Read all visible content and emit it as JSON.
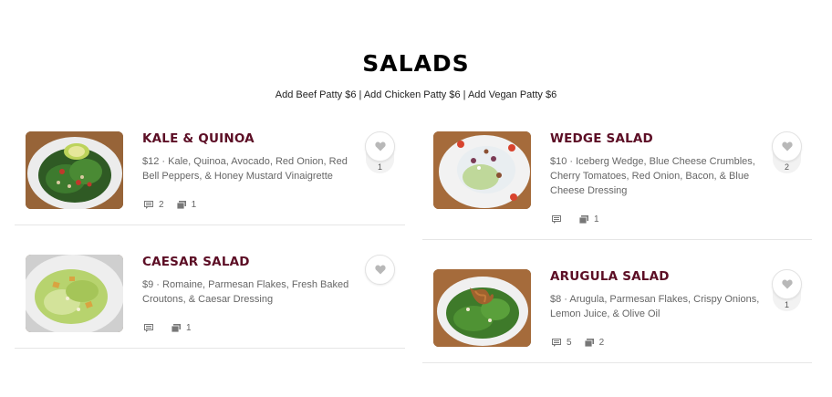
{
  "heading": "SALADS",
  "addons": "Add Beef Patty $6 | Add Chicken Patty $6 | Add Vegan Patty $6",
  "items": [
    {
      "name": "KALE & QUINOA",
      "description": "$12 · Kale, Quinoa, Avocado, Red Onion, Red Bell Peppers, & Honey Mustard Vinaigrette",
      "comments": "2",
      "photos": "1",
      "likes": "1"
    },
    {
      "name": "CAESAR SALAD",
      "description": "$9 · Romaine, Parmesan Flakes, Fresh Baked Croutons, & Caesar Dressing",
      "comments": "",
      "photos": "1",
      "likes": ""
    },
    {
      "name": "WEDGE SALAD",
      "description": "$10 · Iceberg Wedge, Blue Cheese Crumbles, Cherry Tomatoes, Red Onion, Bacon, & Blue Cheese Dressing",
      "comments": "",
      "photos": "1",
      "likes": "2"
    },
    {
      "name": "ARUGULA SALAD",
      "description": "$8 · Arugula, Parmesan Flakes, Crispy Onions, Lemon Juice, & Olive Oil",
      "comments": "5",
      "photos": "2",
      "likes": "1"
    }
  ],
  "icons": {
    "comment": "comment-icon",
    "photo": "photo-icon",
    "like": "heart-icon"
  },
  "colors": {
    "item_name": "#5c0e25",
    "heading": "#000000",
    "divider": "#e6e6e6"
  }
}
